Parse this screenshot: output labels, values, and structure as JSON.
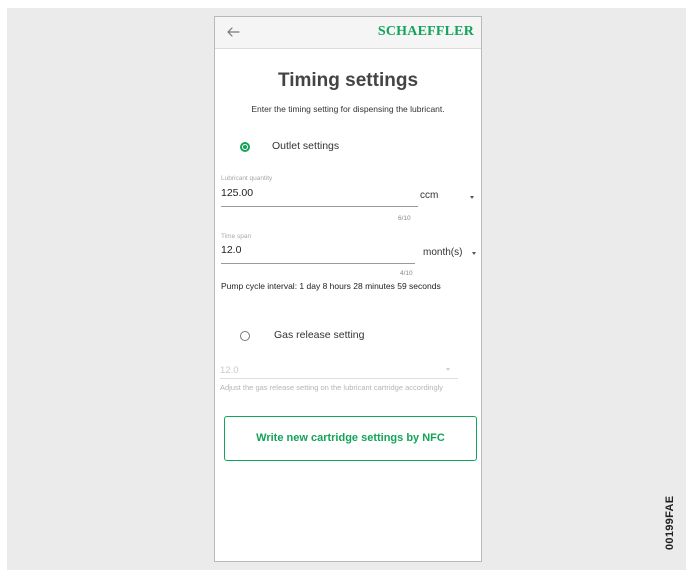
{
  "figure_id": "00199FAE",
  "appbar": {
    "back_icon": "arrow-left-icon",
    "brand": "SCHAEFFLER",
    "brand_color": "#14a35a"
  },
  "page": {
    "title": "Timing settings",
    "subtitle": "Enter the timing setting for dispensing the lubricant."
  },
  "outlet": {
    "radio_label": "Outlet settings",
    "selected": true,
    "lubricant_quantity": {
      "label": "Lubricant quantity",
      "value": "125.00",
      "unit": "ccm",
      "counter": "6/10"
    },
    "time_span": {
      "label": "Time span",
      "value": "12.0",
      "unit": "month(s)",
      "counter": "4/10"
    },
    "pump_cycle_interval": "Pump cycle interval: 1 day 8 hours 28 minutes 59 seconds"
  },
  "gas_release": {
    "radio_label": "Gas release setting",
    "selected": false,
    "value": "12.0",
    "hint": "Adjust the gas release setting on the lubricant cartridge accordingly"
  },
  "nfc_button": {
    "label": "Write new cartridge settings by NFC"
  }
}
